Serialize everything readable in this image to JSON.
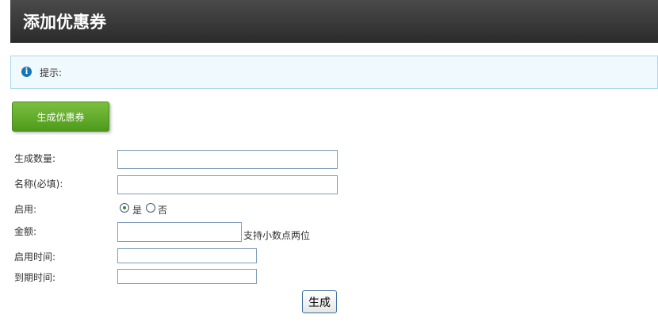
{
  "header": {
    "title": "添加优惠券"
  },
  "notice": {
    "text": "提示:"
  },
  "actions": {
    "generate_coupon_label": "生成优惠券"
  },
  "form": {
    "quantity": {
      "label": "生成数量:",
      "value": ""
    },
    "name": {
      "label": "名称(必填):",
      "value": ""
    },
    "enabled": {
      "label": "启用:",
      "options": [
        {
          "label": "是",
          "checked": true
        },
        {
          "label": "否",
          "checked": false
        }
      ]
    },
    "amount": {
      "label": "金额:",
      "value": "",
      "hint": "支持小数点两位"
    },
    "start_time": {
      "label": "启用时间:",
      "value": ""
    },
    "end_time": {
      "label": "到期时间:",
      "value": ""
    },
    "submit_label": "生成"
  },
  "colors": {
    "header_bg": "#333333",
    "notice_bg": "#f0f9fd",
    "notice_border": "#a9d8ee",
    "green_button": "#62ad2b",
    "info_icon": "#1575b8"
  },
  "icons": {
    "notice": "info-icon"
  }
}
